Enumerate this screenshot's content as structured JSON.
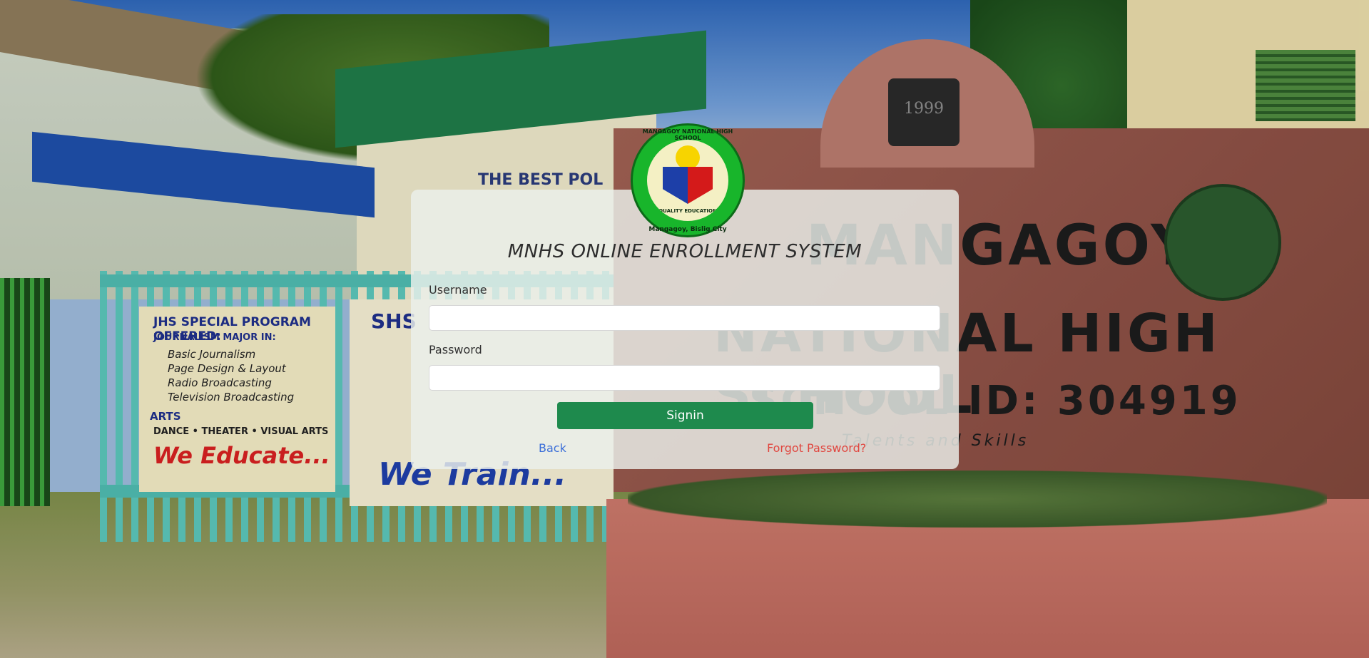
{
  "page": {
    "title": "MNHS ONLINE ENROLLMENT SYSTEM"
  },
  "logo": {
    "text_top": "MANGAGOY NATIONAL HIGH SCHOOL",
    "text_bottom": "Mangagoy, Bislig City",
    "text_band": "QUALITY EDUCATION"
  },
  "background": {
    "arch_year": "1999",
    "wall_line1": "MANGAGOY",
    "wall_line2": "NATIONAL HIGH SCHOOL",
    "wall_line3": "SCHOOL ID: 304919",
    "wall_motto": "Talents and Skills",
    "banner1_title": "JHS SPECIAL PROGRAM OFFERED:",
    "banner1_sub": "JOURNALISM MAJOR IN:",
    "banner1_items": [
      "Basic Journalism",
      "Page Design & Layout",
      "Radio Broadcasting",
      "Television Broadcasting"
    ],
    "banner1_arts": "ARTS",
    "banner1_arts_items": "DANCE • THEATER • VISUAL ARTS",
    "banner1_slogan": "We Educate...",
    "banner2_title": "SHS",
    "banner2_slogan": "We Train...",
    "sign_text": "THE BEST POL"
  },
  "form": {
    "username_label": "Username",
    "username_value": "",
    "password_label": "Password",
    "password_value": "",
    "signin_label": "Signin",
    "back_label": "Back",
    "forgot_label": "Forgot Password?"
  },
  "colors": {
    "signin_bg": "#1e8a4d",
    "back_link": "#3b6ed8",
    "forgot_link": "#e0463f"
  }
}
